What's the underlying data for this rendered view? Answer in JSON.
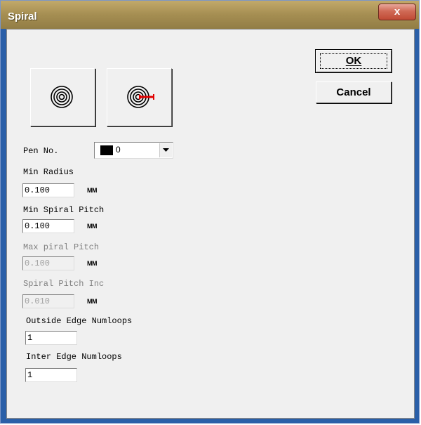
{
  "window": {
    "title": "Spiral",
    "close_glyph": "x"
  },
  "buttons": {
    "ok_label": "OK",
    "cancel_label": "Cancel"
  },
  "icons": {
    "spiral_in": "concentric-circles-icon",
    "spiral_out": "concentric-circles-arrow-icon"
  },
  "pen": {
    "label": "Pen No.",
    "value": "0",
    "swatch_color": "#000000"
  },
  "fields": {
    "min_radius": {
      "label": "Min Radius",
      "value": "0.100",
      "unit": "MM"
    },
    "min_spiral_pitch": {
      "label": "Min Spiral Pitch",
      "value": "0.100",
      "unit": "MM"
    },
    "max_spiral_pitch": {
      "label": "Max piral Pitch",
      "value": "0.100",
      "unit": "MM"
    },
    "spiral_pitch_inc": {
      "label": "Spiral Pitch Inc",
      "value": "0.010",
      "unit": "MM"
    },
    "outside_edge_numloops": {
      "label": "Outside Edge Numloops",
      "value": "1"
    },
    "inter_edge_numloops": {
      "label": "Inter Edge Numloops",
      "value": "1"
    }
  },
  "colors": {
    "title_bar": "#a58e52",
    "close_button": "#d06a55",
    "arrow_accent": "#e00000"
  }
}
